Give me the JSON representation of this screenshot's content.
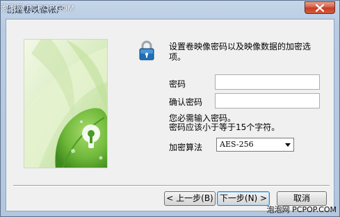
{
  "window": {
    "title": "创建卷映像帐户",
    "watermark_top": "泡泡网 PCPOP.COM",
    "watermark_bottom": "泡泡网 PCPOP.COM"
  },
  "description": "设置卷映像密码以及映像数据的加密选项。",
  "form": {
    "password_label": "密码",
    "password_value": "",
    "confirm_label": "确认密码",
    "confirm_value": "",
    "note_line1": "您必需输入密码。",
    "note_line2": "密码应该小于等于15个字符。",
    "algorithm_label": "加密算法",
    "algorithm_value": "AES-256"
  },
  "buttons": {
    "back": "< 上一步(B)",
    "next": "下一步(N) >",
    "cancel": "取消"
  },
  "icons": {
    "lock": "lock-icon",
    "close": "close-icon",
    "dropdown": "chevron-down-icon"
  },
  "colors": {
    "title_bar": "#c5d5ea",
    "close_button": "#c43d25",
    "lock_body": "#1e6fb8",
    "art_leaf": "#7cc24a"
  }
}
